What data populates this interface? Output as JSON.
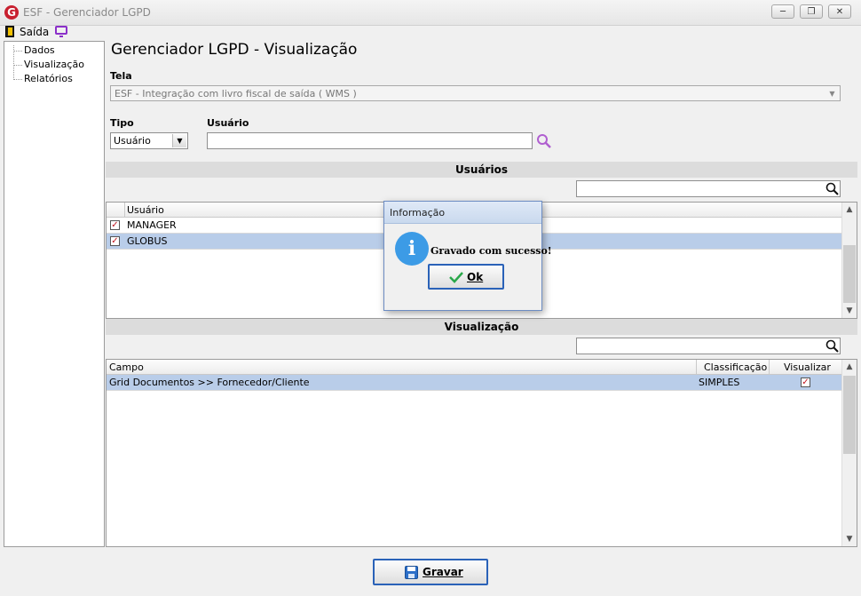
{
  "window": {
    "title": "ESF - Gerenciador LGPD",
    "app_icon_letter": "G"
  },
  "menu": {
    "exit_label": "Saída"
  },
  "tree": {
    "items": [
      "Dados",
      "Visualização",
      "Relatórios"
    ]
  },
  "page": {
    "heading": "Gerenciador LGPD - Visualização"
  },
  "tela": {
    "label": "Tela",
    "value": "ESF - Integração com livro fiscal de saída ( WMS )"
  },
  "tipo": {
    "label": "Tipo",
    "value": "Usuário"
  },
  "usuario_field": {
    "label": "Usuário",
    "value": ""
  },
  "users_section": {
    "header": "Usuários",
    "column": "Usuário",
    "rows": [
      {
        "name": "MANAGER",
        "checked": true
      },
      {
        "name": "GLOBUS",
        "checked": true,
        "selected": true
      }
    ]
  },
  "visual_section": {
    "header": "Visualização",
    "columns": [
      "Campo",
      "Classificação",
      "Visualizar"
    ],
    "rows": [
      {
        "campo": "Grid Documentos >> Fornecedor/Cliente",
        "classificacao": "SIMPLES",
        "visualizar": true
      }
    ]
  },
  "dialog": {
    "title": "Informação",
    "message": "Gravado com sucesso!",
    "ok_label": "Ok"
  },
  "footer": {
    "save_label": "Gravar"
  },
  "colors": {
    "selection": "#b9cde9",
    "info_blue": "#3c9be6",
    "check_red": "#c0141e",
    "brand_red": "#c8202f"
  }
}
